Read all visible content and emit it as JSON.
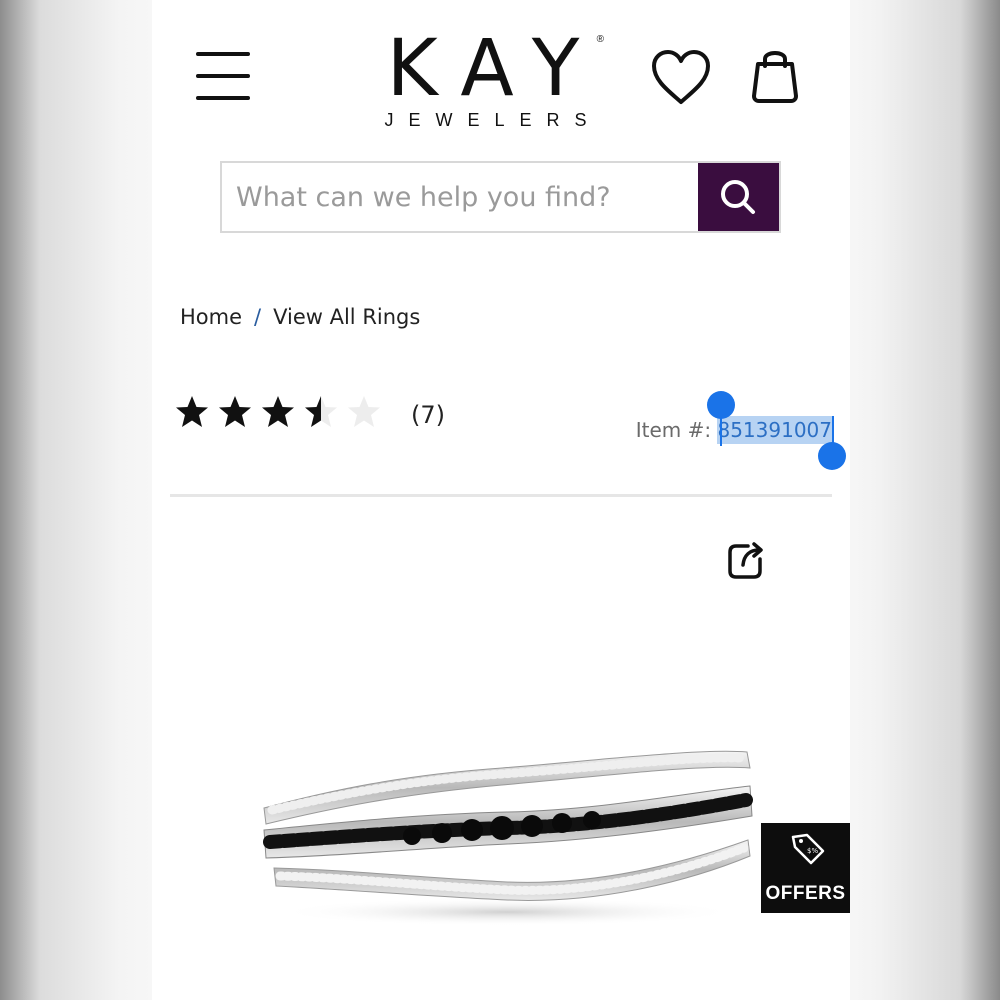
{
  "header": {
    "brand_main": "KAY",
    "brand_sub": "JEWELERS",
    "brand_reg": "®",
    "icons": [
      "menu-icon",
      "heart-icon",
      "shopping-bag-icon"
    ]
  },
  "search": {
    "placeholder": "What can we help you find?",
    "button_icon": "search-icon",
    "button_color": "#3a0d3f"
  },
  "breadcrumb": {
    "items": [
      "Home",
      "View All Rings"
    ],
    "separator": "/"
  },
  "rating": {
    "stars": 3.5,
    "max": 5,
    "count": "(7)"
  },
  "item": {
    "label": "Item #:",
    "number": "851391007"
  },
  "actions": {
    "share_icon": "share-icon"
  },
  "offers": {
    "label": "OFFERS",
    "icon": "price-tag-icon"
  },
  "colors": {
    "brand_purple": "#3a0d3f",
    "selection": "#b7d3f3",
    "selection_handle": "#1a73e8"
  }
}
